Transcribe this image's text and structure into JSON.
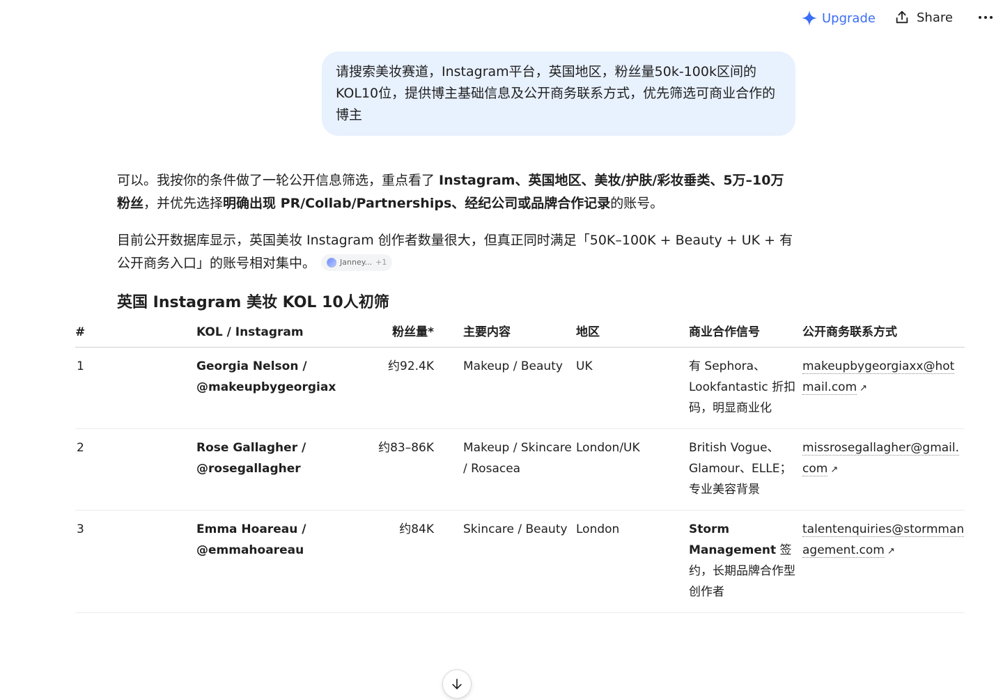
{
  "header": {
    "upgrade_label": "Upgrade",
    "share_label": "Share",
    "accent_color": "#3b6ef5"
  },
  "user_message": {
    "text": "请搜索美妆赛道，Instagram平台，英国地区，粉丝量50k-100k区间的KOL10位，提供博主基础信息及公开商务联系方式，优先筛选可商业合作的博主"
  },
  "answer": {
    "p1": {
      "t1": "可以。我按你的条件做了一轮公开信息筛选，重点看了 ",
      "b1": "Instagram、英国地区、美妆/护肤/彩妆垂类、5万–10万粉丝",
      "t2": "，并优先选择",
      "b2": "明确出现 PR/Collab/Partnerships、经纪公司或品牌合作记录",
      "t3": "的账号。"
    },
    "p2": {
      "text": "目前公开数据库显示，英国美妆 Instagram 创作者数量很大，但真正同时满足「50K–100K + Beauty + UK + 有公开商务入口」的账号相对集中。",
      "citation_label": "Janney...",
      "citation_more": "+1"
    },
    "table_title": "英国 Instagram 美妆 KOL 10人初筛"
  },
  "table": {
    "headers": [
      "#",
      "KOL / Instagram",
      "粉丝量*",
      "主要内容",
      "地区",
      "商业合作信号",
      "公开商务联系方式"
    ],
    "rows": [
      {
        "no": "1",
        "kol_name": "Georgia Nelson /",
        "kol_handle": "@makeupbygeorgiax",
        "followers": "约92.4K",
        "content": "Makeup / Beauty",
        "region": "UK",
        "signal_bold": "",
        "signal": "有 Sephora、Lookfantastic 折扣码，明显商业化",
        "contact": "makeupbygeorgiaxx@hotmail.com"
      },
      {
        "no": "2",
        "kol_name": "Rose Gallagher /",
        "kol_handle": "@rosegallagher",
        "followers": "约83–86K",
        "content": "Makeup / Skincare / Rosacea",
        "region": "London/UK",
        "signal_bold": "",
        "signal": "British Vogue、Glamour、ELLE；专业美容背景",
        "contact": "missrosegallagher@gmail.com"
      },
      {
        "no": "3",
        "kol_name": "Emma Hoareau /",
        "kol_handle": "@emmahoareau",
        "followers": "约84K",
        "content": "Skincare / Beauty",
        "region": "London",
        "signal_bold": "Storm Management",
        "signal": " 签约，长期品牌合作型创作者",
        "contact": "talentenquiries@stormmanagement.com"
      }
    ]
  }
}
